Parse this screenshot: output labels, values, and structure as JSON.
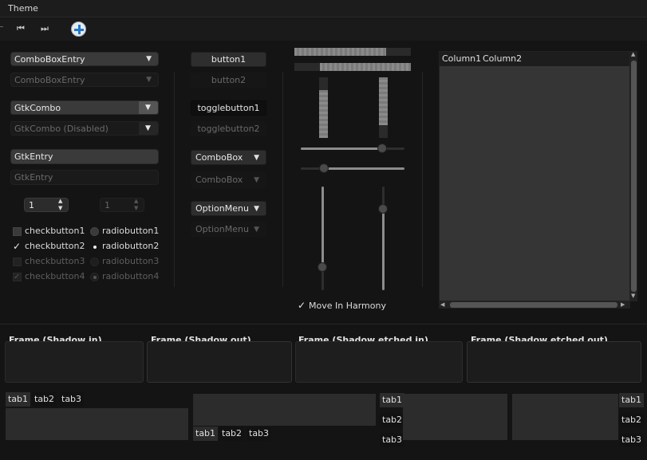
{
  "menubar": {
    "theme": "Theme"
  },
  "toolbar": {
    "first_glyph": "⏮",
    "last_glyph": "⏭"
  },
  "col1": {
    "combo_entry": "ComboBoxEntry",
    "combo_entry_dis": "ComboBoxEntry",
    "gtkcombo": "GtkCombo",
    "gtkcombo_dis": "GtkCombo (Disabled)",
    "entry": "GtkEntry",
    "entry_dis": "GtkEntry",
    "spin": "1",
    "spin_dis": "1",
    "checks": [
      "checkbutton1",
      "checkbutton2",
      "checkbutton3",
      "checkbutton4"
    ],
    "radios": [
      "radiobutton1",
      "radiobutton2",
      "radiobutton3",
      "radiobutton4"
    ]
  },
  "col2": {
    "button1": "button1",
    "button2": "button2",
    "toggle1": "togglebutton1",
    "toggle2": "togglebutton2",
    "combobox": "ComboBox",
    "combobox_dis": "ComboBox",
    "optionmenu": "OptionMenu",
    "optionmenu_dis": "OptionMenu"
  },
  "col3": {
    "harmony": "Move In Harmony"
  },
  "tree": {
    "columns": [
      "Column1",
      "Column2"
    ]
  },
  "frames": [
    "Frame (Shadow in)",
    "Frame (Shadow out)",
    "Frame (Shadow etched in)",
    "Frame (Shadow etched out)"
  ],
  "tabs": [
    "tab1",
    "tab2",
    "tab3"
  ],
  "glyphs": {
    "arrow": "▼",
    "updown": "▲▼",
    "check": "✓",
    "left": "◀",
    "right": "▶",
    "up": "▲",
    "down": "▼"
  }
}
